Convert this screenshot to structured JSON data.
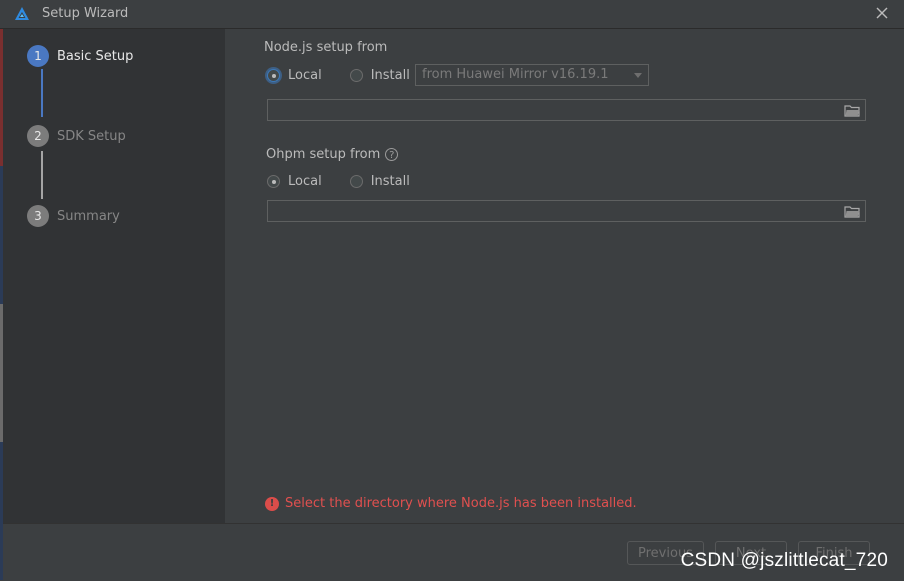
{
  "window": {
    "title": "Setup Wizard",
    "app_icon": "deveco-logo-icon",
    "close_icon": "close-icon"
  },
  "sidebar": {
    "steps": [
      {
        "number": "1",
        "label": "Basic Setup",
        "active": true
      },
      {
        "number": "2",
        "label": "SDK Setup",
        "active": false
      },
      {
        "number": "3",
        "label": "Summary",
        "active": false
      }
    ]
  },
  "nodejs": {
    "label": "Node.js setup from",
    "local_label": "Local",
    "install_label": "Install",
    "selected": "Local",
    "mirror_value": "from Huawei Mirror v16.19.1",
    "path_value": ""
  },
  "ohpm": {
    "label": "Ohpm setup from",
    "help_icon": "?",
    "local_label": "Local",
    "install_label": "Install",
    "selected": "Local",
    "path_value": ""
  },
  "error": {
    "icon": "!",
    "message": "Select the directory where Node.js has been installed."
  },
  "footer": {
    "previous_label": "Previous",
    "next_label": "Next",
    "finish_label": "Finish"
  },
  "watermark": "CSDN @jszlittlecat_720",
  "colors": {
    "accent": "#3d79b8",
    "active_step": "#4a78c2",
    "inactive_step": "#7c7c7c",
    "error": "#e0504f",
    "background": "#3c3f41",
    "sidebar": "#313335"
  }
}
